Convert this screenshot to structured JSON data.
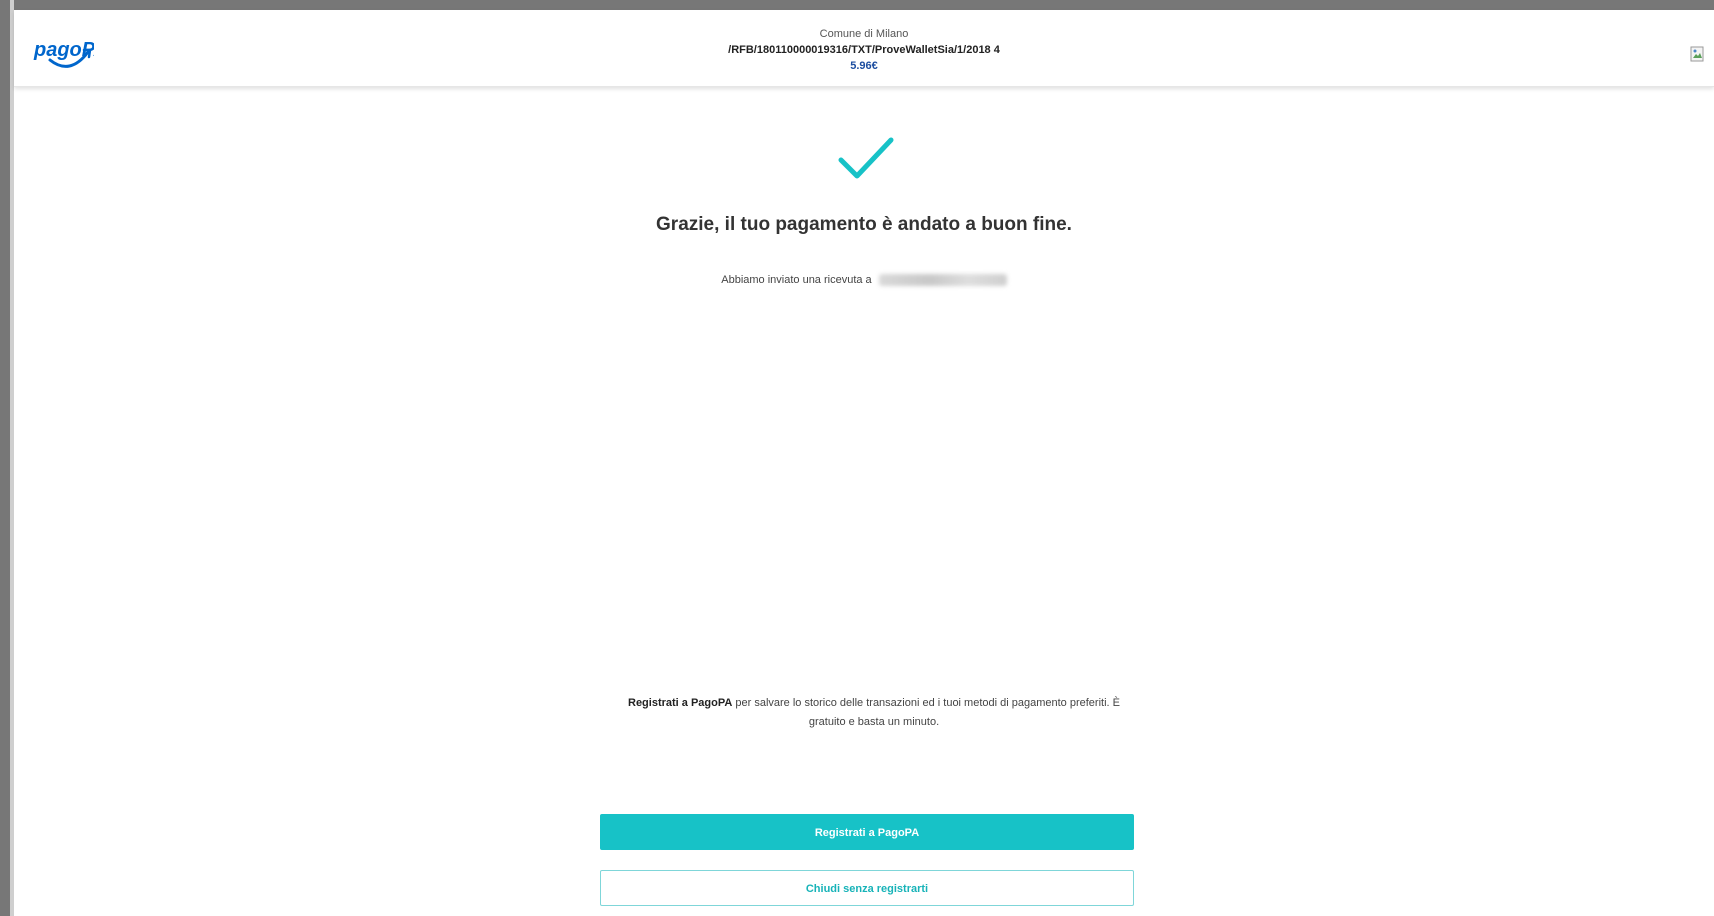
{
  "header": {
    "logo_text": "pagoPA",
    "creditor": "Comune di Milano",
    "reference": "/RFB/180110000019316/TXT/ProveWalletSia/1/2018 4",
    "amount": "5.96€"
  },
  "main": {
    "success_icon": "checkmark-icon",
    "title": "Grazie, il tuo pagamento è andato a buon fine.",
    "receipt_text": "Abbiamo inviato una ricevuta a"
  },
  "register": {
    "text_strong": "Registrati a PagoPA",
    "text_rest": " per salvare lo storico delle transazioni ed i tuoi metodi di pagamento preferiti. È gratuito e basta un minuto.",
    "primary_button": "Registrati a PagoPA",
    "secondary_button": "Chiudi senza registrarti"
  },
  "colors": {
    "accent": "#17c2c7",
    "amount": "#1d4ea0",
    "logo": "#0066cc"
  }
}
